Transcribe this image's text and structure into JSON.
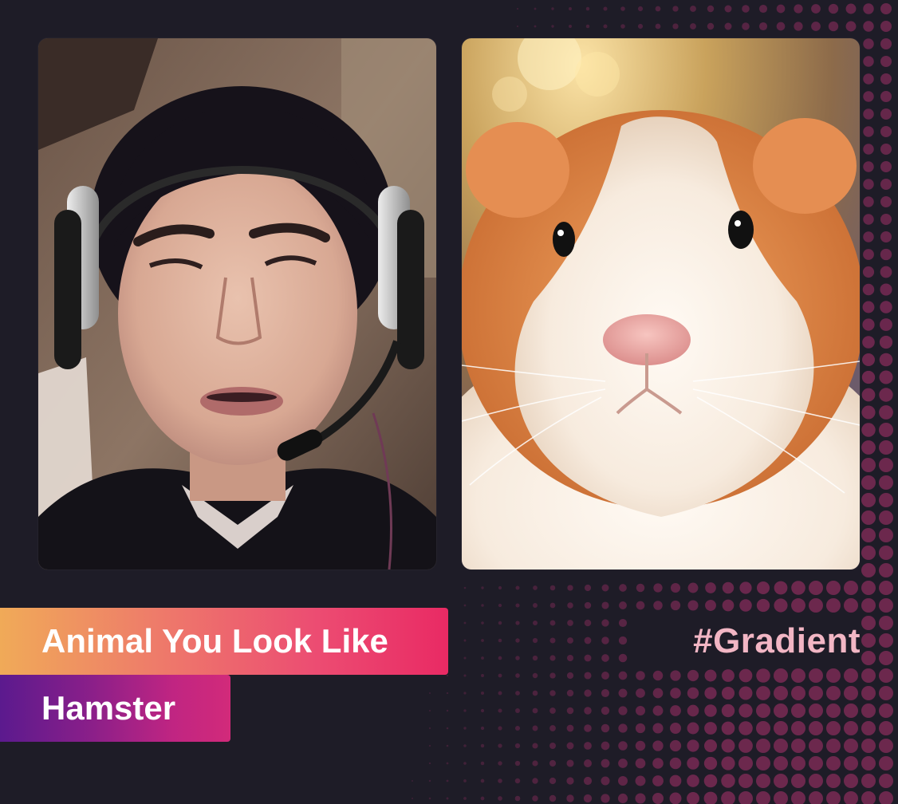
{
  "photos": {
    "left": {
      "icon": "person-with-headset-photo"
    },
    "right": {
      "icon": "guinea-pig-photo"
    }
  },
  "banners": {
    "title": "Animal You Look Like",
    "result": "Hamster"
  },
  "hashtag": "#Gradient",
  "colors": {
    "background": "#1e1c27",
    "title_gradient_start": "#f0aa58",
    "title_gradient_end": "#e92a64",
    "result_gradient_start": "#5b1a8e",
    "result_gradient_end": "#d22a7a",
    "hashtag": "#f2b6c4",
    "dot_accent": "#7a2a55"
  }
}
